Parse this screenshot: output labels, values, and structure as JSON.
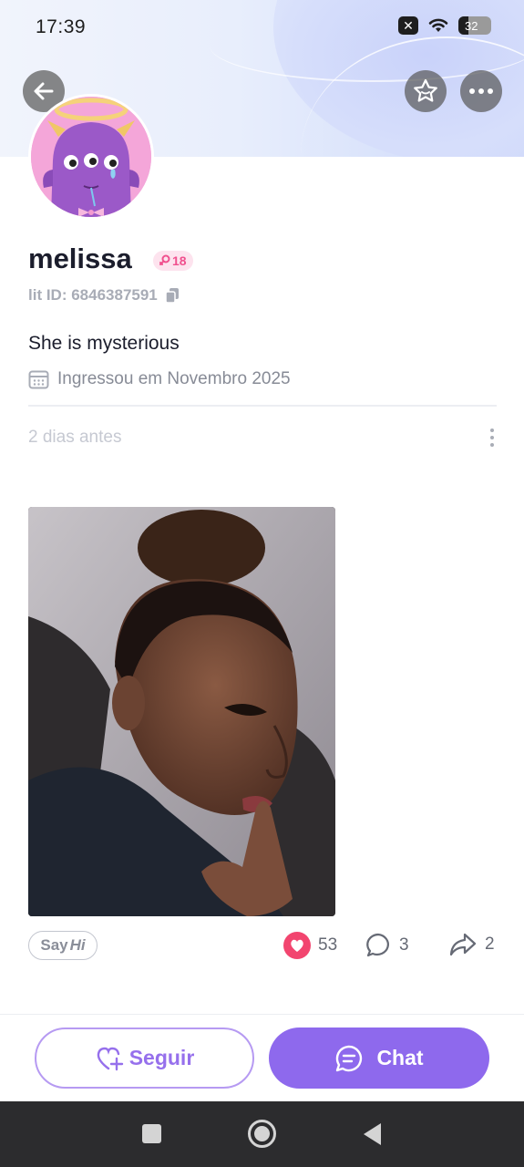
{
  "status_bar": {
    "time": "17:39",
    "battery": "32"
  },
  "profile": {
    "name": "melissa",
    "age_badge": "18",
    "lit_id": "lit ID: 6846387591",
    "bio": "She is mysterious",
    "joined": "Ingressou em Novembro 2025"
  },
  "post": {
    "time": "2 dias antes",
    "say_hi": {
      "say": "Say",
      "hi": "Hi"
    },
    "likes": "53",
    "comments": "3",
    "shares": "2"
  },
  "actions": {
    "follow_label": "Seguir",
    "chat_label": "Chat"
  },
  "colors": {
    "accent": "#8e69ed",
    "like": "#f2456f",
    "age_badge": "#f0508e"
  },
  "icons": {
    "back": "arrow-left-icon",
    "favorite": "star-icon",
    "more": "more-dots-icon",
    "copy": "copy-icon",
    "calendar": "calendar-icon",
    "like": "heart-icon",
    "comment": "comment-bubble-icon",
    "share": "share-arrow-icon",
    "follow": "heart-plus-icon",
    "chat": "chat-bubble-icon"
  }
}
